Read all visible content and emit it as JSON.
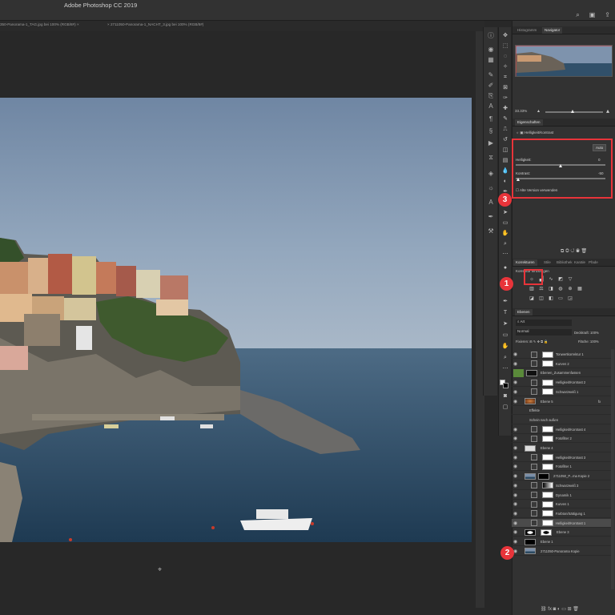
{
  "app": {
    "title": "Adobe Photoshop CC 2019"
  },
  "window_icons": [
    "search-icon",
    "workspace-icon",
    "share-icon"
  ],
  "doc_tabs": [
    {
      "label": "350-Panorama-1_TAG.jpg bei 100% (RGB/8#)",
      "close": "×"
    },
    {
      "label": "2711050-Panorama-1_NACHT_3.jpg bei 100% (RGB/8#)",
      "close": "×"
    }
  ],
  "navigator": {
    "tabs": [
      "Histogramm",
      "Navigator"
    ],
    "active_tab": "Navigator",
    "zoom": "33.33%"
  },
  "properties": {
    "header": "Eigenschaften",
    "adjustment_name": "Helligkeit/Kontrast",
    "auto_button": "Auto",
    "brightness_label": "Helligkeit:",
    "brightness_value": "0",
    "contrast_label": "Kontrast:",
    "contrast_value": "-50",
    "legacy_label": "Alte Version verwenden"
  },
  "adjustments": {
    "tabs": [
      "Korrekturen",
      "Stile",
      "Bibliothek",
      "Kanäle",
      "Pfade"
    ],
    "active_tab": "Korrekturen",
    "add_label": "Korrektur hinzufügen"
  },
  "layers_panel": {
    "header": "Ebenen",
    "filter": "Art",
    "blend_mode": "Normal",
    "opacity_label": "Deckkraft:",
    "opacity_value": "100%",
    "fix_label": "Fixieren:",
    "fill_label": "Fläche:",
    "fill_value": "100%"
  },
  "layers": [
    {
      "name": "Tonwertkorrektur 1",
      "type": "adj"
    },
    {
      "name": "Kurven 2",
      "type": "adj"
    },
    {
      "name": "Ebenen_Zusammenfassen",
      "type": "group"
    },
    {
      "name": "Helligkeit/Kontrast 2",
      "type": "adj"
    },
    {
      "name": "Schwarzweiß 1",
      "type": "adj"
    },
    {
      "name": "Ebene 5",
      "type": "image",
      "fx": "fx"
    },
    {
      "name": "Effekte",
      "type": "effect"
    },
    {
      "name": "Schein nach außen",
      "type": "effect"
    },
    {
      "name": "Helligkeit/Kontrast 4",
      "type": "adj"
    },
    {
      "name": "Fotofilter 2",
      "type": "adj"
    },
    {
      "name": "Ebene 4",
      "type": "image"
    },
    {
      "name": "Helligkeit/Kontrast 3",
      "type": "adj"
    },
    {
      "name": "Fotofilter 1",
      "type": "adj"
    },
    {
      "name": "2711050_P...ma Kopie 2",
      "type": "image"
    },
    {
      "name": "Schwarzweiß 3",
      "type": "adj"
    },
    {
      "name": "Dynamik 1",
      "type": "adj"
    },
    {
      "name": "Kurven 1",
      "type": "adj"
    },
    {
      "name": "Farbton/Sättigung 1",
      "type": "adj"
    },
    {
      "name": "Helligkeit/Kontrast 1",
      "type": "adj",
      "selected": true
    },
    {
      "name": "Ebene 3",
      "type": "mask"
    },
    {
      "name": "Ebene 1",
      "type": "black"
    },
    {
      "name": "2711050-Panorama Kopie",
      "type": "image"
    }
  ],
  "callouts": [
    "1",
    "2",
    "3"
  ],
  "colors": {
    "callout": "#e8343a",
    "panel": "#323232",
    "canvas": "#282828",
    "group": "#5a8a3a"
  }
}
